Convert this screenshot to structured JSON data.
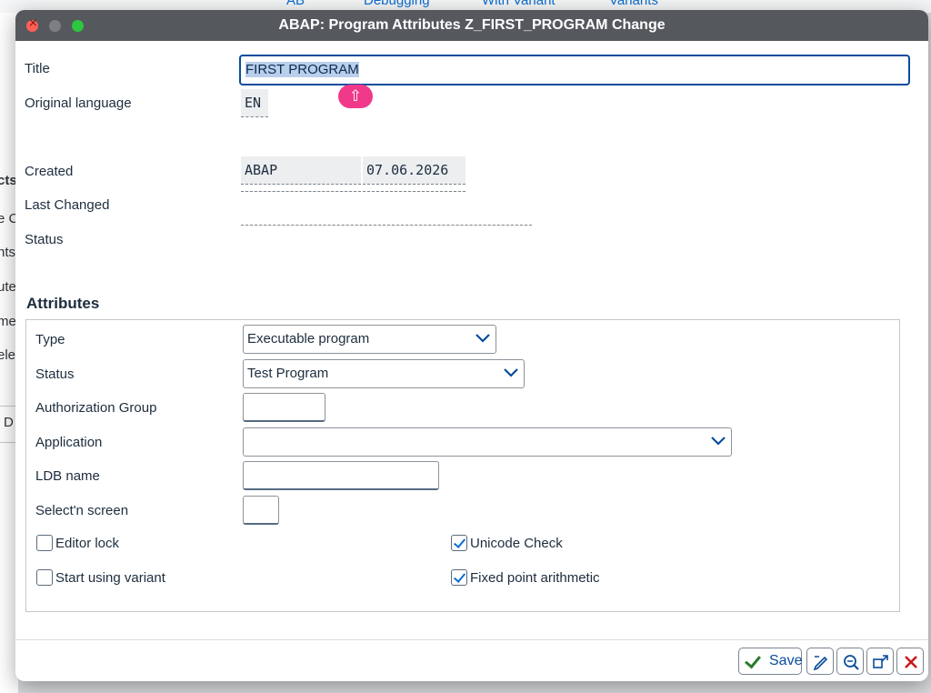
{
  "background": {
    "toolbar_items": [
      "Debugging",
      "With Variant",
      "Variants",
      "AB"
    ],
    "left_fragments": [
      "cts",
      "e C",
      "nts",
      "ute",
      "me",
      "ele",
      "D"
    ]
  },
  "window": {
    "title": "ABAP: Program Attributes Z_FIRST_PROGRAM Change"
  },
  "header": {
    "title_label": "Title",
    "title_value": "FIRST PROGRAM",
    "original_language_label": "Original language",
    "original_language_value": "EN",
    "created_label": "Created",
    "created_by": "ABAP",
    "created_date": "07.06.2026",
    "last_changed_label": "Last Changed",
    "last_changed_by": "",
    "last_changed_date": "",
    "status_label": "Status",
    "status_value": ""
  },
  "attributes": {
    "section_title": "Attributes",
    "type_label": "Type",
    "type_value": "Executable program",
    "status_label": "Status",
    "status_value": "Test Program",
    "auth_group_label": "Authorization Group",
    "auth_group_value": "",
    "application_label": "Application",
    "application_value": "",
    "ldb_label": "LDB name",
    "ldb_value": "",
    "selscreen_label": "Select'n screen",
    "selscreen_value": "",
    "editor_lock_label": "Editor lock",
    "editor_lock_checked": false,
    "start_variant_label": "Start using variant",
    "start_variant_checked": false,
    "unicode_label": "Unicode Check",
    "unicode_checked": true,
    "fixed_point_label": "Fixed point arithmetic",
    "fixed_point_checked": true
  },
  "footer": {
    "save_label": "Save",
    "icons": [
      "edit-icon",
      "zoom-icon",
      "expand-icon",
      "close-icon"
    ]
  },
  "colors": {
    "accent": "#0a6ed1",
    "titlebar": "#55595e",
    "close_btn": "#cc1919",
    "save_check": "#2b7c2b",
    "badge": "#f0398b"
  }
}
